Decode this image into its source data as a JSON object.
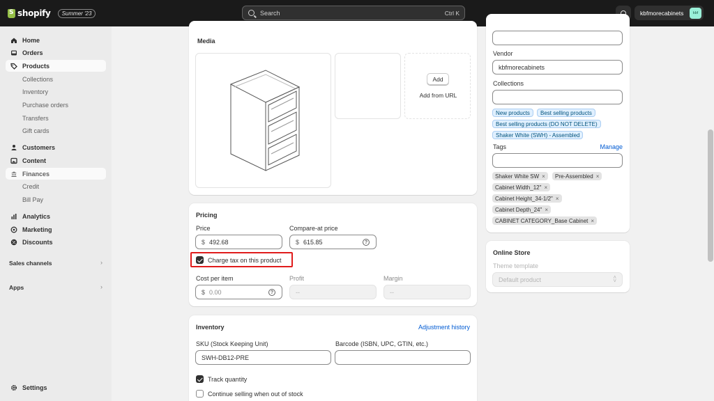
{
  "topbar": {
    "brand": "shopify",
    "edition": "Summer '23",
    "search_placeholder": "Search",
    "search_shortcut": "Ctrl K",
    "store_name": "kbfmorecabinets",
    "avatar_initials": "kbf"
  },
  "sidebar": {
    "items": [
      {
        "label": "Home",
        "icon": "home-icon"
      },
      {
        "label": "Orders",
        "icon": "inbox-icon"
      },
      {
        "label": "Products",
        "icon": "tag-icon"
      },
      {
        "label": "Collections"
      },
      {
        "label": "Inventory"
      },
      {
        "label": "Purchase orders"
      },
      {
        "label": "Transfers"
      },
      {
        "label": "Gift cards"
      },
      {
        "label": "Customers",
        "icon": "person-icon"
      },
      {
        "label": "Content",
        "icon": "image-icon"
      },
      {
        "label": "Finances",
        "icon": "bank-icon"
      },
      {
        "label": "Credit"
      },
      {
        "label": "Bill Pay"
      },
      {
        "label": "Analytics",
        "icon": "chart-icon"
      },
      {
        "label": "Marketing",
        "icon": "target-icon"
      },
      {
        "label": "Discounts",
        "icon": "discount-icon"
      }
    ],
    "sales_channels": "Sales channels",
    "apps": "Apps",
    "settings": "Settings"
  },
  "media": {
    "title": "Media",
    "add_button": "Add",
    "add_from_url": "Add from URL"
  },
  "pricing": {
    "title": "Pricing",
    "price_label": "Price",
    "price_currency": "$",
    "price_value": "492.68",
    "compare_label": "Compare-at price",
    "compare_currency": "$",
    "compare_value": "615.85",
    "charge_tax_label": "Charge tax on this product",
    "charge_tax_checked": true,
    "cost_label": "Cost per item",
    "cost_currency": "$",
    "cost_placeholder": "0.00",
    "profit_label": "Profit",
    "profit_value": "--",
    "margin_label": "Margin",
    "margin_value": "--"
  },
  "inventory": {
    "title": "Inventory",
    "history_link": "Adjustment history",
    "sku_label": "SKU (Stock Keeping Unit)",
    "sku_value": "SWH-DB12-PRE",
    "barcode_label": "Barcode (ISBN, UPC, GTIN, etc.)",
    "barcode_value": "",
    "track_label": "Track quantity",
    "track_checked": true,
    "continue_label": "Continue selling when out of stock",
    "continue_checked": false
  },
  "organization": {
    "vendor_label": "Vendor",
    "vendor_value": "kbfmorecabinets",
    "collections_label": "Collections",
    "collections": [
      "New products",
      "Best selling products",
      "Best selling products (DO NOT DELETE)",
      "Shaker White (SWH) - Assembled"
    ],
    "tags_label": "Tags",
    "manage_link": "Manage",
    "tags": [
      "Shaker White SW",
      "Pre-Assembled",
      "Cabinet Width_12\"",
      "Cabinet Height_34-1/2\"",
      "Cabinet Depth_24\"",
      "CABINET CATEGORY_Base Cabinet"
    ]
  },
  "online_store": {
    "title": "Online Store",
    "theme_label": "Theme template",
    "theme_value": "Default product"
  },
  "colors": {
    "accent": "#005bd3",
    "topbar": "#1a1a1a",
    "highlight": "#e01b1b"
  }
}
